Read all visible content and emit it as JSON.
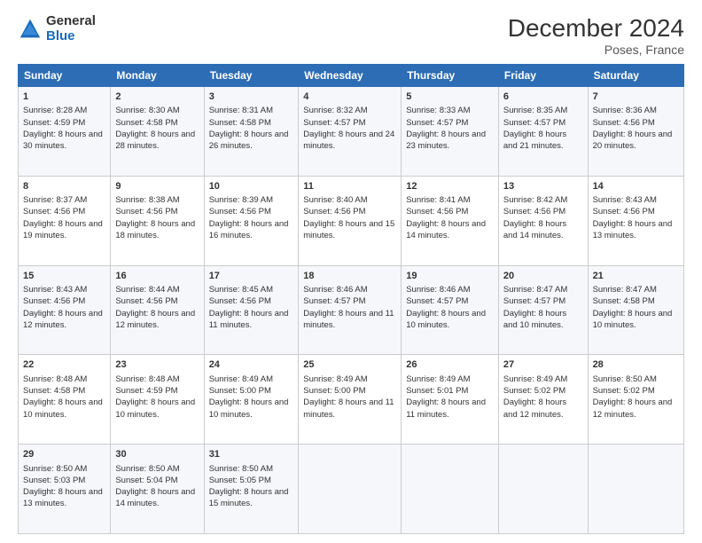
{
  "logo": {
    "general": "General",
    "blue": "Blue"
  },
  "title": "December 2024",
  "subtitle": "Poses, France",
  "headers": [
    "Sunday",
    "Monday",
    "Tuesday",
    "Wednesday",
    "Thursday",
    "Friday",
    "Saturday"
  ],
  "weeks": [
    [
      {
        "day": "1",
        "sunrise": "Sunrise: 8:28 AM",
        "sunset": "Sunset: 4:59 PM",
        "daylight": "Daylight: 8 hours and 30 minutes."
      },
      {
        "day": "2",
        "sunrise": "Sunrise: 8:30 AM",
        "sunset": "Sunset: 4:58 PM",
        "daylight": "Daylight: 8 hours and 28 minutes."
      },
      {
        "day": "3",
        "sunrise": "Sunrise: 8:31 AM",
        "sunset": "Sunset: 4:58 PM",
        "daylight": "Daylight: 8 hours and 26 minutes."
      },
      {
        "day": "4",
        "sunrise": "Sunrise: 8:32 AM",
        "sunset": "Sunset: 4:57 PM",
        "daylight": "Daylight: 8 hours and 24 minutes."
      },
      {
        "day": "5",
        "sunrise": "Sunrise: 8:33 AM",
        "sunset": "Sunset: 4:57 PM",
        "daylight": "Daylight: 8 hours and 23 minutes."
      },
      {
        "day": "6",
        "sunrise": "Sunrise: 8:35 AM",
        "sunset": "Sunset: 4:57 PM",
        "daylight": "Daylight: 8 hours and 21 minutes."
      },
      {
        "day": "7",
        "sunrise": "Sunrise: 8:36 AM",
        "sunset": "Sunset: 4:56 PM",
        "daylight": "Daylight: 8 hours and 20 minutes."
      }
    ],
    [
      {
        "day": "8",
        "sunrise": "Sunrise: 8:37 AM",
        "sunset": "Sunset: 4:56 PM",
        "daylight": "Daylight: 8 hours and 19 minutes."
      },
      {
        "day": "9",
        "sunrise": "Sunrise: 8:38 AM",
        "sunset": "Sunset: 4:56 PM",
        "daylight": "Daylight: 8 hours and 18 minutes."
      },
      {
        "day": "10",
        "sunrise": "Sunrise: 8:39 AM",
        "sunset": "Sunset: 4:56 PM",
        "daylight": "Daylight: 8 hours and 16 minutes."
      },
      {
        "day": "11",
        "sunrise": "Sunrise: 8:40 AM",
        "sunset": "Sunset: 4:56 PM",
        "daylight": "Daylight: 8 hours and 15 minutes."
      },
      {
        "day": "12",
        "sunrise": "Sunrise: 8:41 AM",
        "sunset": "Sunset: 4:56 PM",
        "daylight": "Daylight: 8 hours and 14 minutes."
      },
      {
        "day": "13",
        "sunrise": "Sunrise: 8:42 AM",
        "sunset": "Sunset: 4:56 PM",
        "daylight": "Daylight: 8 hours and 14 minutes."
      },
      {
        "day": "14",
        "sunrise": "Sunrise: 8:43 AM",
        "sunset": "Sunset: 4:56 PM",
        "daylight": "Daylight: 8 hours and 13 minutes."
      }
    ],
    [
      {
        "day": "15",
        "sunrise": "Sunrise: 8:43 AM",
        "sunset": "Sunset: 4:56 PM",
        "daylight": "Daylight: 8 hours and 12 minutes."
      },
      {
        "day": "16",
        "sunrise": "Sunrise: 8:44 AM",
        "sunset": "Sunset: 4:56 PM",
        "daylight": "Daylight: 8 hours and 12 minutes."
      },
      {
        "day": "17",
        "sunrise": "Sunrise: 8:45 AM",
        "sunset": "Sunset: 4:56 PM",
        "daylight": "Daylight: 8 hours and 11 minutes."
      },
      {
        "day": "18",
        "sunrise": "Sunrise: 8:46 AM",
        "sunset": "Sunset: 4:57 PM",
        "daylight": "Daylight: 8 hours and 11 minutes."
      },
      {
        "day": "19",
        "sunrise": "Sunrise: 8:46 AM",
        "sunset": "Sunset: 4:57 PM",
        "daylight": "Daylight: 8 hours and 10 minutes."
      },
      {
        "day": "20",
        "sunrise": "Sunrise: 8:47 AM",
        "sunset": "Sunset: 4:57 PM",
        "daylight": "Daylight: 8 hours and 10 minutes."
      },
      {
        "day": "21",
        "sunrise": "Sunrise: 8:47 AM",
        "sunset": "Sunset: 4:58 PM",
        "daylight": "Daylight: 8 hours and 10 minutes."
      }
    ],
    [
      {
        "day": "22",
        "sunrise": "Sunrise: 8:48 AM",
        "sunset": "Sunset: 4:58 PM",
        "daylight": "Daylight: 8 hours and 10 minutes."
      },
      {
        "day": "23",
        "sunrise": "Sunrise: 8:48 AM",
        "sunset": "Sunset: 4:59 PM",
        "daylight": "Daylight: 8 hours and 10 minutes."
      },
      {
        "day": "24",
        "sunrise": "Sunrise: 8:49 AM",
        "sunset": "Sunset: 5:00 PM",
        "daylight": "Daylight: 8 hours and 10 minutes."
      },
      {
        "day": "25",
        "sunrise": "Sunrise: 8:49 AM",
        "sunset": "Sunset: 5:00 PM",
        "daylight": "Daylight: 8 hours and 11 minutes."
      },
      {
        "day": "26",
        "sunrise": "Sunrise: 8:49 AM",
        "sunset": "Sunset: 5:01 PM",
        "daylight": "Daylight: 8 hours and 11 minutes."
      },
      {
        "day": "27",
        "sunrise": "Sunrise: 8:49 AM",
        "sunset": "Sunset: 5:02 PM",
        "daylight": "Daylight: 8 hours and 12 minutes."
      },
      {
        "day": "28",
        "sunrise": "Sunrise: 8:50 AM",
        "sunset": "Sunset: 5:02 PM",
        "daylight": "Daylight: 8 hours and 12 minutes."
      }
    ],
    [
      {
        "day": "29",
        "sunrise": "Sunrise: 8:50 AM",
        "sunset": "Sunset: 5:03 PM",
        "daylight": "Daylight: 8 hours and 13 minutes."
      },
      {
        "day": "30",
        "sunrise": "Sunrise: 8:50 AM",
        "sunset": "Sunset: 5:04 PM",
        "daylight": "Daylight: 8 hours and 14 minutes."
      },
      {
        "day": "31",
        "sunrise": "Sunrise: 8:50 AM",
        "sunset": "Sunset: 5:05 PM",
        "daylight": "Daylight: 8 hours and 15 minutes."
      },
      null,
      null,
      null,
      null
    ]
  ]
}
